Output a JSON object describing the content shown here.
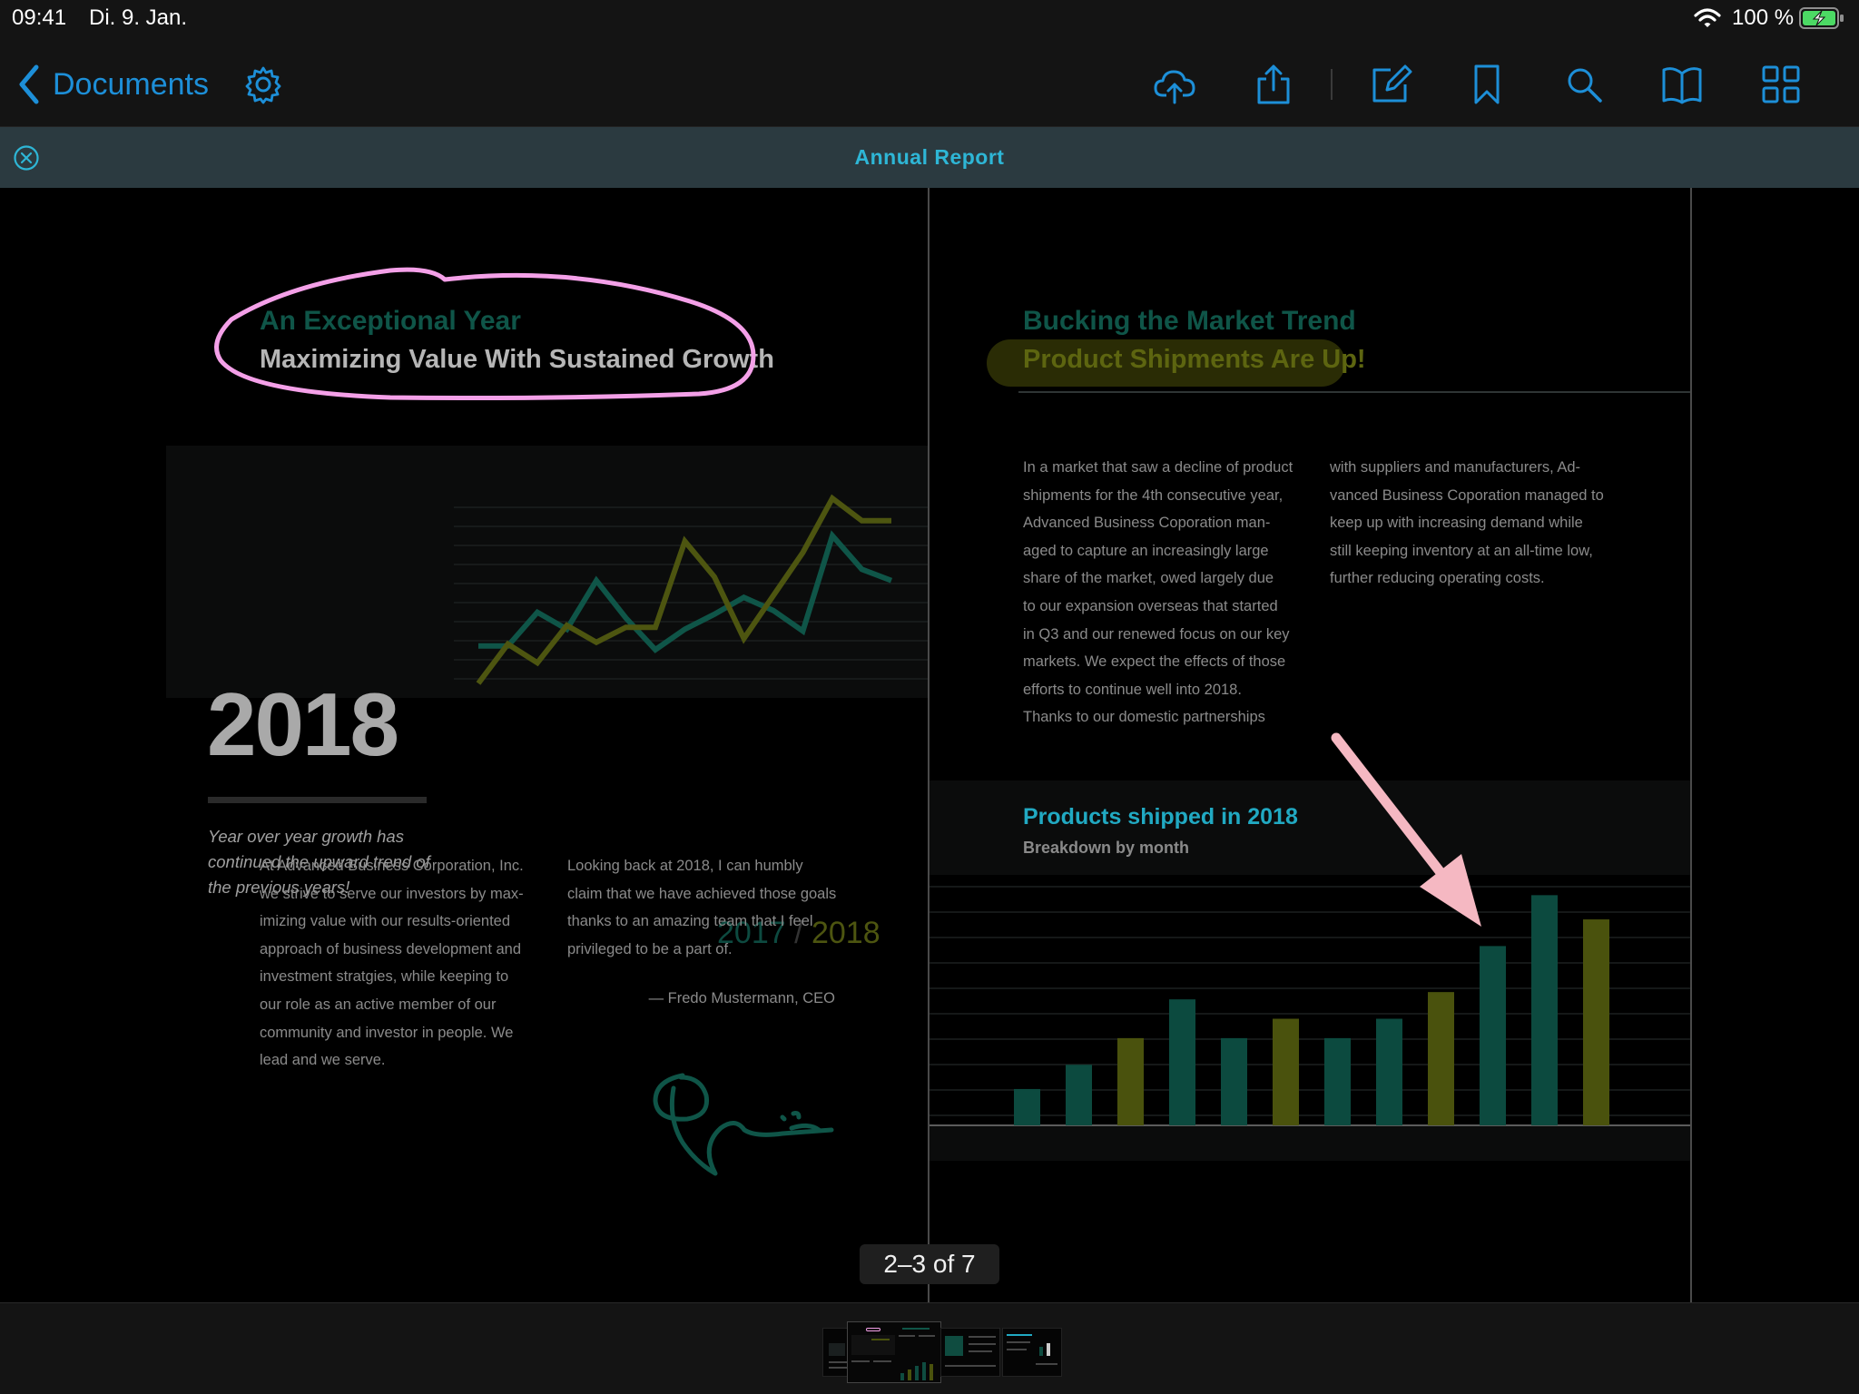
{
  "status_bar": {
    "time": "09:41",
    "date": "Di. 9. Jan.",
    "battery_percent": "100 %"
  },
  "toolbar": {
    "back_label": "Documents",
    "icons": [
      "settings-gear-icon",
      "cloud-upload-icon",
      "share-icon",
      "edit-annotate-icon",
      "bookmark-icon",
      "search-icon",
      "reading-mode-book-icon",
      "grid-view-icon"
    ]
  },
  "document": {
    "title": "Annual Report",
    "page_indicator": "2–3 of 7",
    "left_page": {
      "heading": "An Exceptional Year",
      "subheading": "Maximizing Value With Sustained Growth",
      "year": "2018",
      "year_note": "Year over year growth has continued the upward trend of the previous years!",
      "comparison_label": {
        "a": "2017",
        "sep": " / ",
        "b": "2018"
      },
      "col1": [
        "At Advanced Business Corporation, Inc.",
        "we strive to serve our investors  by max-",
        "imizing value with our results-oriented",
        "approach of business development and",
        "investment stratgies, while keeping to",
        "our role as an active member of our",
        "community and investor in people. We",
        "lead and we serve."
      ],
      "col2": [
        "Looking back at 2018, I can humbly",
        "claim that we have achieved those goals",
        "thanks to an amazing team that I feel",
        "privileged to be a part of."
      ],
      "signature": "— Fredo Mustermann, CEO"
    },
    "right_page": {
      "heading": "Bucking the Market Trend",
      "subheading": "Product Shipments Are Up!",
      "col1": [
        "In a market that saw a decline of product",
        "shipments for the 4th consecutive year,",
        "Advanced Business Coporation man-",
        "aged to capture an increasingly large",
        "share of the market, owed largely due",
        "to our expansion overseas that started",
        "in Q3 and our renewed focus on our key",
        "markets. We expect the effects of those",
        "efforts to continue well into 2018.",
        "Thanks to our domestic partnerships"
      ],
      "col2": [
        "with suppliers and manufacturers, Ad-",
        "vanced Business Coporation managed to",
        "keep up with increasing demand while",
        "still keeping inventory at an all-time low,",
        "further reducing operating costs."
      ],
      "chart_title": "Products shipped in 2018",
      "chart_subtitle": "Breakdown by month"
    }
  },
  "colors": {
    "accent_blue": "#1d8fd8",
    "title_cyan": "#2eb6d6",
    "highlight_pink": "#f4a0e8",
    "arrow_pink": "#f5b8c2",
    "teal": "#0f5548",
    "olive": "#4d5510"
  },
  "chart_data": [
    {
      "type": "line",
      "title": "",
      "x": [
        1,
        2,
        3,
        4,
        5,
        6,
        7,
        8,
        9,
        10,
        11,
        12,
        13,
        14,
        15
      ],
      "series": [
        {
          "name": "2017",
          "values": [
            20,
            20,
            38,
            29,
            55,
            35,
            18,
            29,
            37,
            46,
            39,
            28,
            79,
            61,
            55
          ]
        },
        {
          "name": "2018",
          "values": [
            0,
            21,
            11,
            31,
            22,
            30,
            30,
            76,
            57,
            24,
            47,
            70,
            99,
            87,
            87
          ]
        }
      ],
      "ylim": [
        0,
        100
      ],
      "grid": true
    },
    {
      "type": "bar",
      "title": "Products shipped in 2018",
      "subtitle": "Breakdown by month",
      "categories": [
        "1",
        "2",
        "3",
        "4",
        "5",
        "6",
        "7",
        "8",
        "9",
        "10",
        "11",
        "12"
      ],
      "values": [
        15,
        25,
        36,
        52,
        36,
        44,
        36,
        44,
        55,
        74,
        95,
        85
      ],
      "ylim": [
        0,
        100
      ],
      "grid": true
    }
  ]
}
